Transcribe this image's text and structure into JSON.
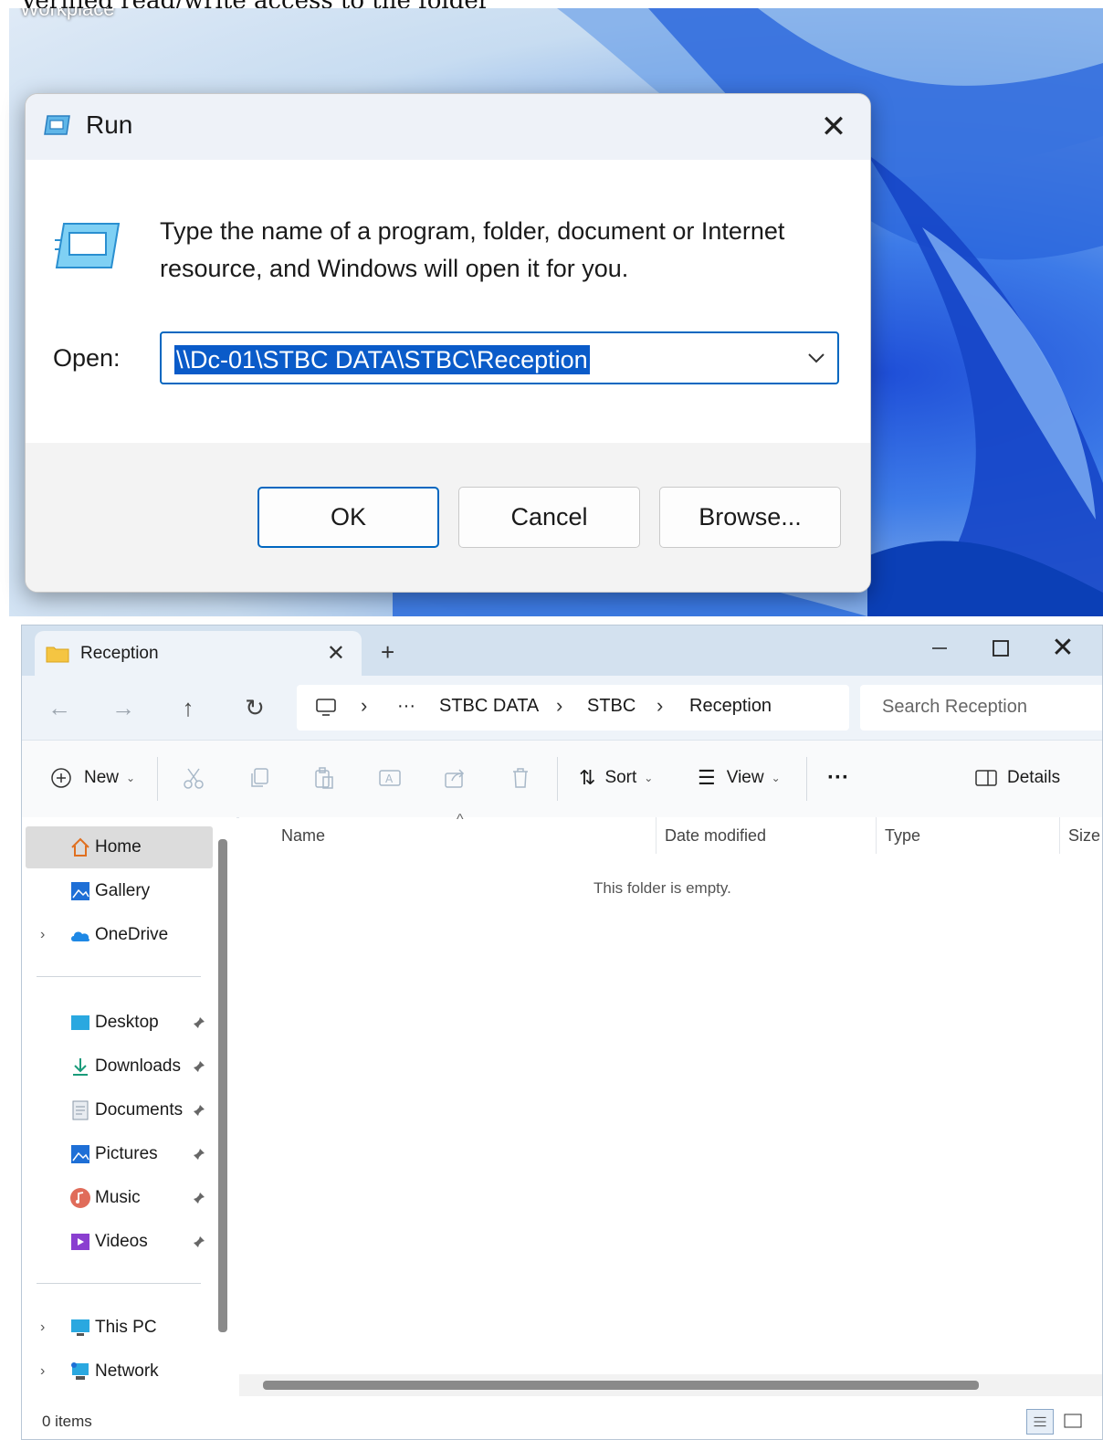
{
  "background": {
    "doc_text": "Verified read/write access to the folder",
    "desktop_label": "Workplace"
  },
  "run_dialog": {
    "title": "Run",
    "description": "Type the name of a program, folder, document or Internet resource, and Windows will open it for you.",
    "open_label": "Open:",
    "open_value": "\\\\Dc-01\\STBC DATA\\STBC\\Reception",
    "buttons": {
      "ok": "OK",
      "cancel": "Cancel",
      "browse": "Browse..."
    },
    "icons": {
      "title": "run-icon",
      "close": "close-icon",
      "dropdown": "chevron-down-icon"
    }
  },
  "explorer": {
    "tab_label": "Reception",
    "breadcrumb": {
      "more": "···",
      "items": [
        "STBC DATA",
        "STBC",
        "Reception"
      ]
    },
    "search_placeholder": "Search Reception",
    "toolbar": {
      "new": "New",
      "sort": "Sort",
      "view": "View",
      "more": "···",
      "details": "Details"
    },
    "nav": {
      "home": "Home",
      "gallery": "Gallery",
      "onedrive": "OneDrive",
      "desktop": "Desktop",
      "downloads": "Downloads",
      "documents": "Documents",
      "pictures": "Pictures",
      "music": "Music",
      "videos": "Videos",
      "this_pc": "This PC",
      "network": "Network"
    },
    "columns": {
      "name": "Name",
      "date_modified": "Date modified",
      "type": "Type",
      "size": "Size"
    },
    "empty_message": "This folder is empty.",
    "status": "0 items"
  },
  "colors": {
    "accent": "#0067c0",
    "selection": "#0a5bc9",
    "titlebar": "#d3e1ef"
  }
}
